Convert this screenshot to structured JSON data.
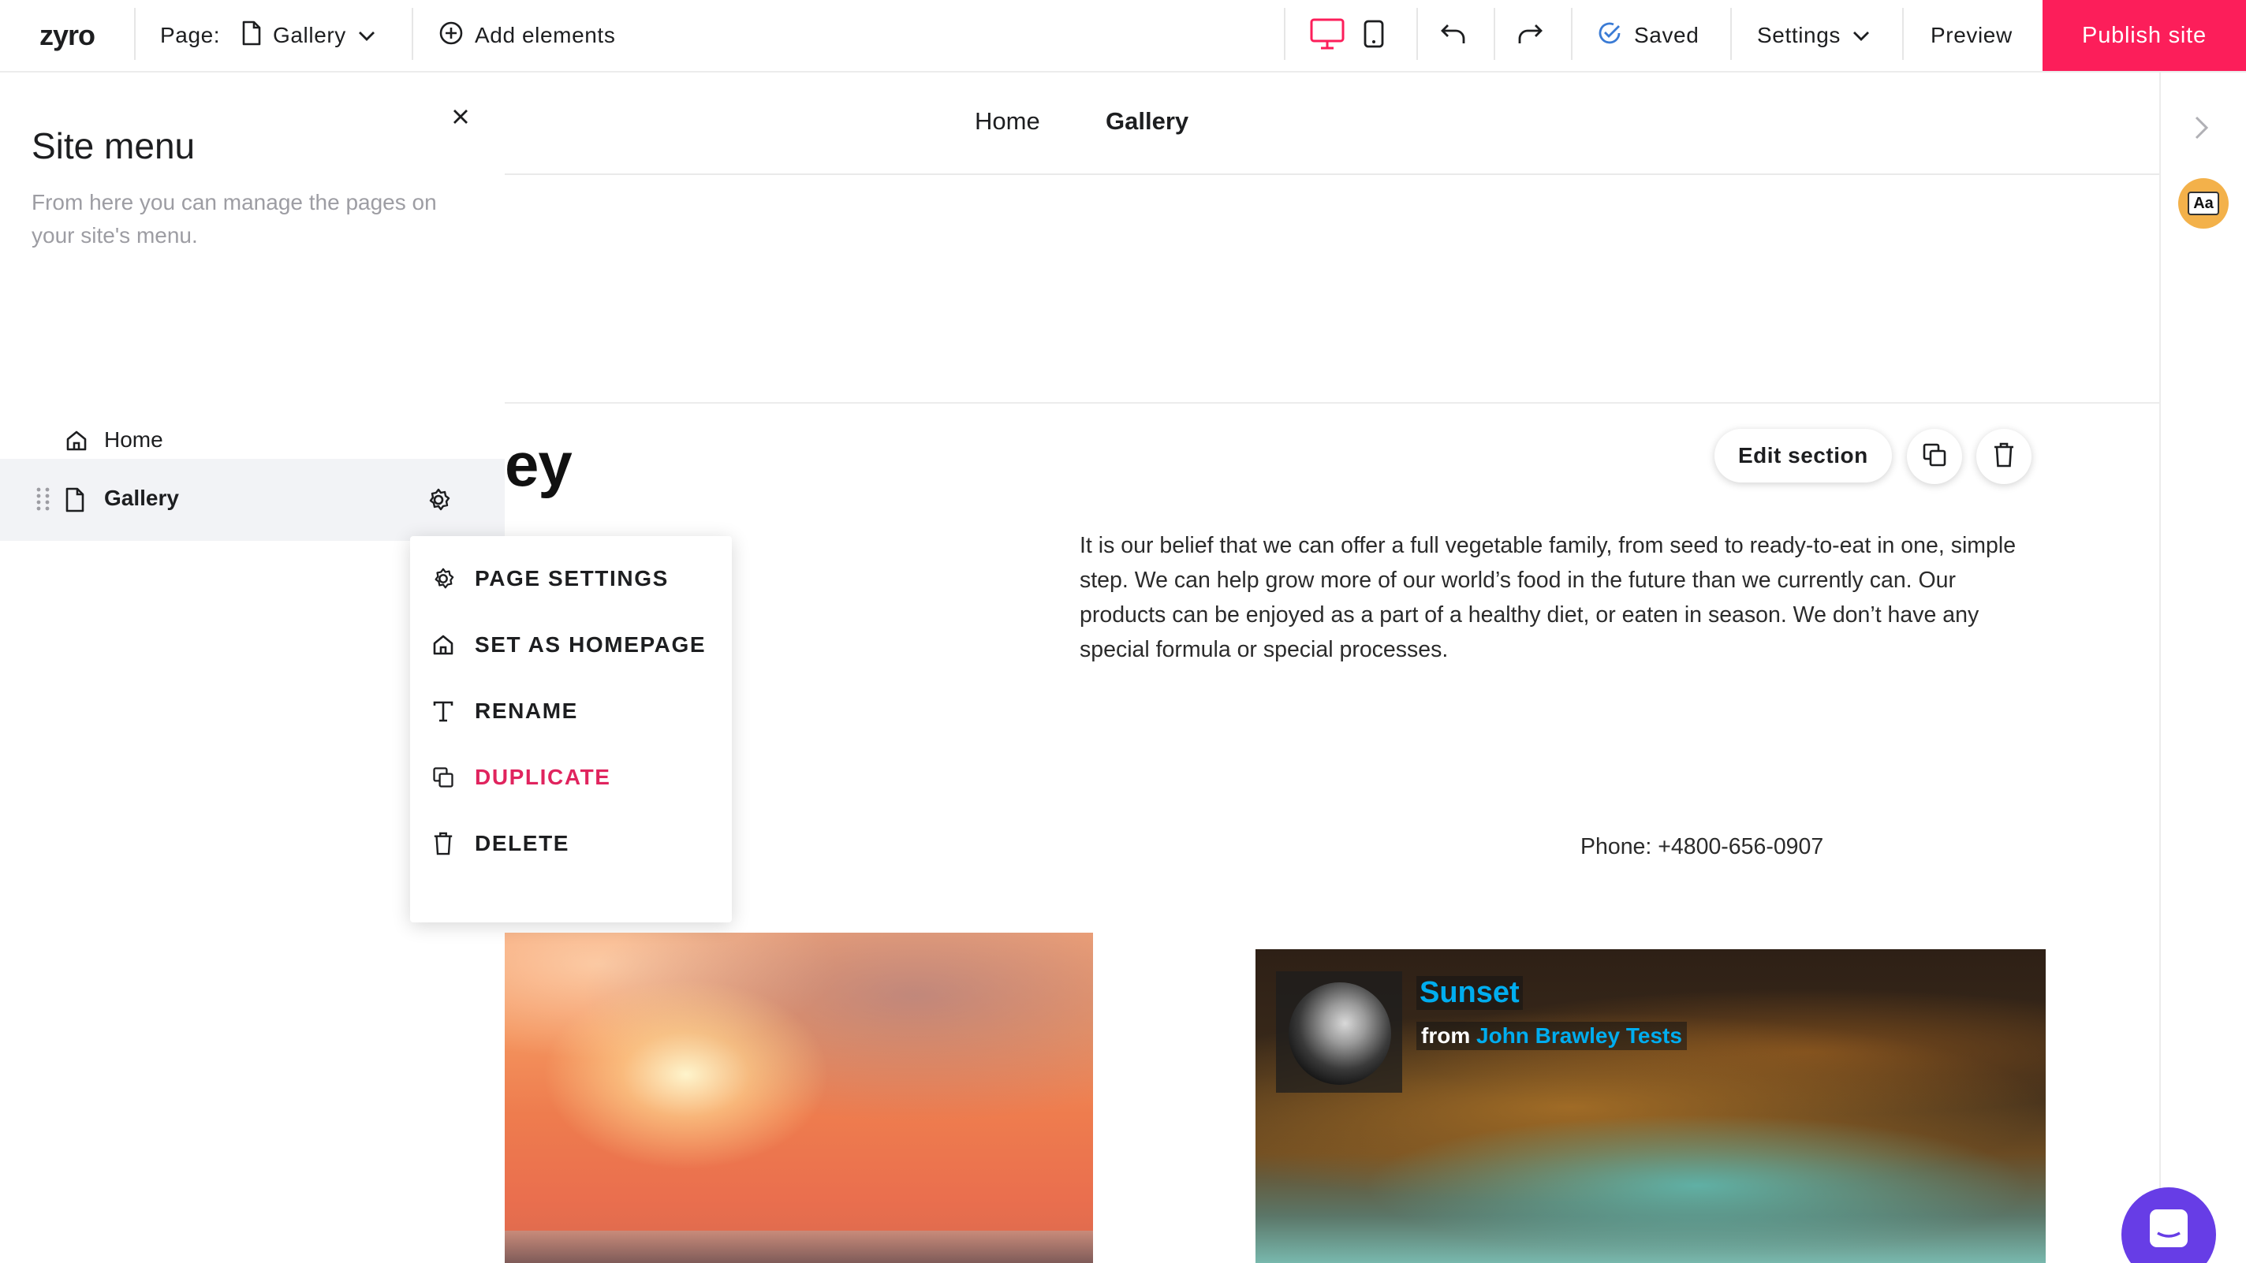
{
  "topbar": {
    "logo": "zyro",
    "page_label": "Page:",
    "current_page": "Gallery",
    "add_elements": "Add elements",
    "saved": "Saved",
    "settings": "Settings",
    "preview": "Preview",
    "publish": "Publish site"
  },
  "colors": {
    "brand_pink": "#fc1e5a",
    "duplicate_red": "#e0245e",
    "saved_blue": "#3a7bd5",
    "chat_purple": "#673de6"
  },
  "site_menu": {
    "title": "Site menu",
    "description": "From here you can manage the pages on your site's menu.",
    "pages": [
      {
        "label": "Home",
        "icon": "home-icon"
      },
      {
        "label": "Gallery",
        "icon": "page-icon",
        "selected": true
      }
    ]
  },
  "page_menu": {
    "items": [
      {
        "label": "PAGE SETTINGS",
        "icon": "gear-icon"
      },
      {
        "label": "SET AS HOMEPAGE",
        "icon": "home-icon"
      },
      {
        "label": "RENAME",
        "icon": "text-icon"
      },
      {
        "label": "DUPLICATE",
        "icon": "duplicate-icon"
      },
      {
        "label": "DELETE",
        "icon": "trash-icon"
      }
    ]
  },
  "site": {
    "nav": {
      "home": "Home",
      "gallery": "Gallery"
    },
    "section_title_fragment": "ey",
    "edit_section": "Edit section",
    "paragraph": "It is our belief that we can offer a full vegetable family, from seed to ready-to-eat in one, simple step. We can help grow more of our world’s food in the future than we currently can. Our products can be enjoyed as a part of a healthy diet, or eaten in season. We don’t have any special formula or special processes.",
    "phone": "Phone: +4800-656-0907",
    "video": {
      "title": "Sunset",
      "from": "from",
      "author": "John Brawley Tests"
    }
  },
  "right_rail": {
    "font_button": "Aa"
  }
}
